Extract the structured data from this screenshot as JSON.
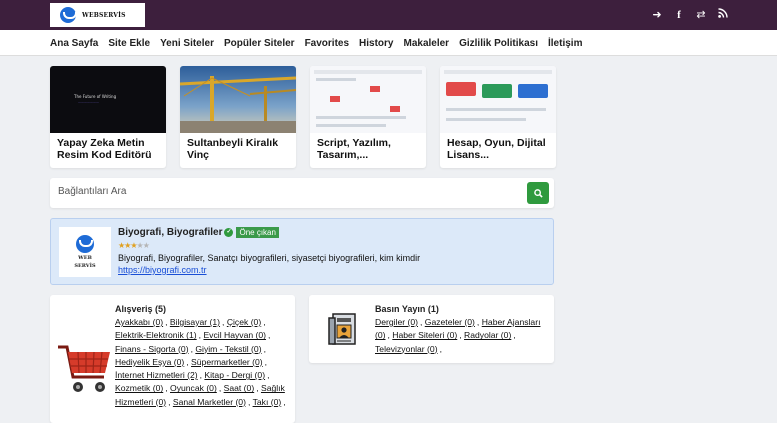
{
  "header": {
    "logo_text": "WEBSERVİS",
    "icons": [
      "login-icon",
      "facebook-icon",
      "shuffle-icon",
      "rss-icon"
    ]
  },
  "nav": {
    "items": [
      "Ana Sayfa",
      "Site Ekle",
      "Yeni Siteler",
      "Popüler Siteler",
      "Favorites",
      "History",
      "Makaleler",
      "Gizlilik Politikası",
      "İletişim"
    ]
  },
  "cards": [
    {
      "title": "Yapay Zeka Metin Resim Kod Editörü",
      "thumb_text": "The Future of Writing"
    },
    {
      "title": "Sultanbeyli Kiralık Vinç"
    },
    {
      "title": "Script, Yazılım, Tasarım,..."
    },
    {
      "title": "Hesap, Oyun, Dijital Lisans..."
    }
  ],
  "search": {
    "placeholder": "Bağlantıları Ara"
  },
  "featured": {
    "logo_line1": "WEB",
    "logo_line2": "SERVİS",
    "title": "Biyografi, Biyografiler",
    "badge": "Öne çıkan",
    "rating": 3,
    "rating_max": 5,
    "description": "Biyografi, Biyografiler, Sanatçı biyografileri, siyasetçi biyografileri, kim kimdir",
    "url": "https://biyografi.com.tr"
  },
  "categories": [
    {
      "title": "Alışveriş (5)",
      "icon": "shopping-cart-icon",
      "links": [
        "Ayakkabı (0)",
        "Bilgisayar (1)",
        "Çiçek (0)",
        "Elektrik-Elektronik (1)",
        "Evcil Hayvan (0)",
        "Finans - Sigorta (0)",
        "Giyim - Tekstil (0)",
        "Hediyelik Eşya (0)",
        "Süpermarketler (0)",
        "İnternet Hizmetleri (2)",
        "Kitap - Dergi (0)",
        "Kozmetik (0)",
        "Oyuncak (0)",
        "Saat (0)",
        "Sağlık Hizmetleri (0)",
        "Sanal Marketler (0)",
        "Takı (0)"
      ]
    },
    {
      "title": "Basın Yayın (1)",
      "icon": "newspaper-icon",
      "links": [
        "Dergiler (0)",
        "Gazeteler (0)",
        "Haber Ajansları (0)",
        "Haber Siteleri (0)",
        "Radyolar (0)",
        "Televizyonlar (0)"
      ]
    }
  ],
  "colors": {
    "topbar": "#3d1f3d",
    "search_button": "#2f9a3e",
    "featured_bg": "#dce9f9",
    "link_blue": "#1a4fd6"
  }
}
